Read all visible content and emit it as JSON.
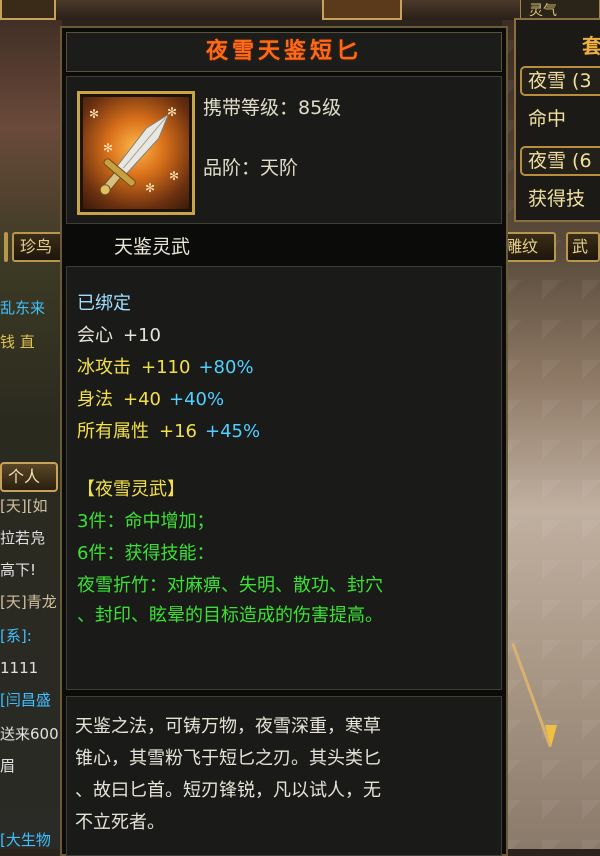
{
  "background": {
    "left_tab": "珍鸟",
    "left_chat_lines": [
      {
        "text": "乱东来",
        "color": "#40c0ff"
      },
      {
        "text": "钱 直",
        "color": "#e0c050"
      },
      {
        "text": "[天][如",
        "color": "#d0c0a0"
      },
      {
        "text": "拉若凫",
        "color": "#e0e0e0"
      },
      {
        "text": "高下!",
        "color": "#e0e0e0"
      },
      {
        "text": "[天]青龙",
        "color": "#d0c0a0"
      },
      {
        "text": "[系]:",
        "color": "#40c0ff"
      },
      {
        "text": "1111",
        "color": "#e0e0e0"
      },
      {
        "text": "[闫昌盛",
        "color": "#40c0ff"
      },
      {
        "text": "送来600",
        "color": "#e0e0e0"
      },
      {
        "text": "眉",
        "color": "#e0e0e0"
      },
      {
        "text": "[大生物",
        "color": "#40c0ff"
      }
    ],
    "left_personal_button": "个人",
    "right_top_tab": "灵气",
    "right_title": "套",
    "right_rows": [
      "夜雪 (3",
      "夜雪 (6"
    ],
    "right_plain": [
      "命中",
      "获得技"
    ],
    "right_tabs": [
      "雕纹",
      "武"
    ]
  },
  "tooltip": {
    "item_name": "夜雪天鉴短匕",
    "carry_level_label": "携带等级：85级",
    "grade_label": "品阶：天阶",
    "set_name": "天鉴灵武",
    "bound": "已绑定",
    "stats": [
      {
        "name": "会心",
        "value": "+10",
        "percent": "",
        "name_color": "white",
        "value_color": "white"
      },
      {
        "name": "冰攻击",
        "value": "+110",
        "percent": "+80%",
        "name_color": "yellow",
        "value_color": "yellow"
      },
      {
        "name": "身法",
        "value": "+40",
        "percent": "+40%",
        "name_color": "yellow",
        "value_color": "yellow"
      },
      {
        "name": "所有属性",
        "value": "+16",
        "percent": "+45%",
        "name_color": "yellow",
        "value_color": "yellow"
      }
    ],
    "set_title": "【夜雪灵武】",
    "set_bonus_3": "3件：命中增加；",
    "set_bonus_6": "6件：获得技能：",
    "skill_line_1": "夜雪折竹：对麻痹、失明、散功、封穴",
    "skill_line_2": "、封印、眩晕的目标造成的伤害提高。",
    "description_lines": [
      "天鉴之法，可铸万物，夜雪深重，寒草",
      "锥心，其雪粉飞于短匕之刃。其头类匕",
      "、故曰匕首。短刃锋锐，凡以试人，无",
      "不立死者。"
    ],
    "colors": {
      "name": "#ff6a1a",
      "yellow": "#f2e04a",
      "percent": "#50d0ff",
      "green": "#3ce034",
      "cyan": "#9fe0ff"
    },
    "icon": "dagger-icon"
  }
}
